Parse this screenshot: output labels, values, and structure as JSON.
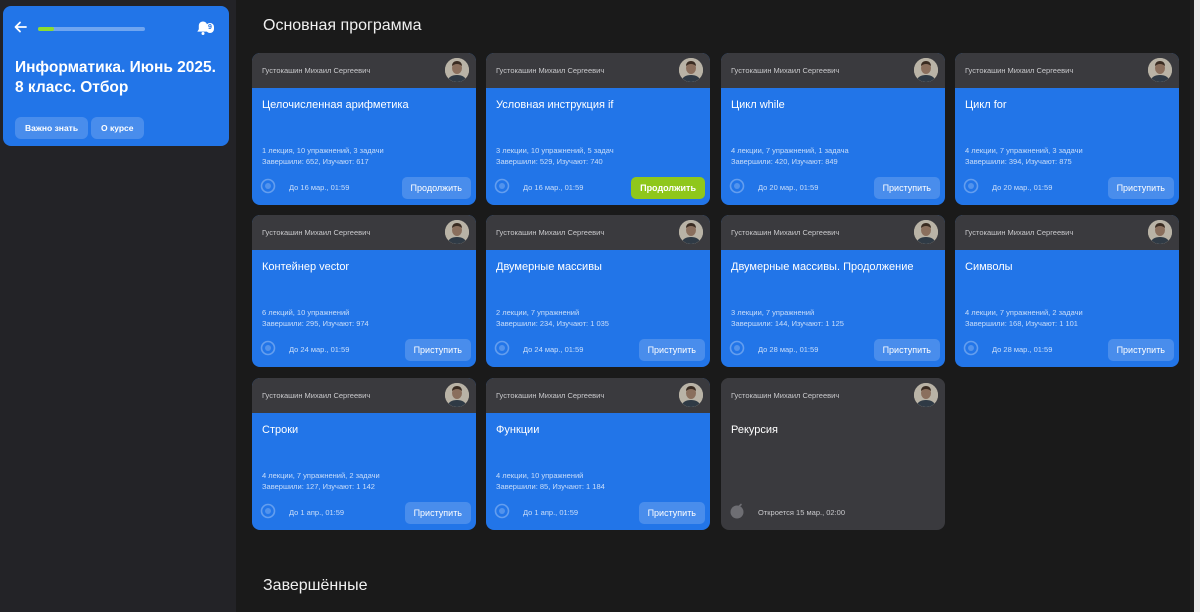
{
  "colors": {
    "card_blue": "#2275e8",
    "card_gray": "#3a3a3e",
    "accent_green": "#8fc71b",
    "background": "#1a1a1a"
  },
  "course": {
    "title": "Информатика. Июнь 2025. 8 класс. Отбор",
    "progress_fraction": 0.15,
    "notifications_count": "9",
    "buttons": [
      "Важно знать",
      "О курсе"
    ]
  },
  "sections": {
    "main_title": "Основная программа",
    "completed_title": "Завершённые"
  },
  "cards": [
    {
      "author": "Густокашин Михаил Сергеевич",
      "title": "Целочисленная арифметика",
      "stats1": "1 лекция, 10 упражнений, 3 задачи",
      "stats2": "Завершили: 652, Изучают: 617",
      "deadline": "До 16 мар., 01:59",
      "action": "Продолжить",
      "state": "blue"
    },
    {
      "author": "Густокашин Михаил Сергеевич",
      "title": "Условная инструкция if",
      "stats1": "3 лекции, 10 упражнений, 5 задач",
      "stats2": "Завершили: 529, Изучают: 740",
      "deadline": "До 16 мар., 01:59",
      "action": "Продолжить",
      "state": "green"
    },
    {
      "author": "Густокашин Михаил Сергеевич",
      "title": "Цикл while",
      "stats1": "4 лекции, 7 упражнений, 1 задача",
      "stats2": "Завершили: 420, Изучают: 849",
      "deadline": "До 20 мар., 01:59",
      "action": "Приступить",
      "state": "blue"
    },
    {
      "author": "Густокашин Михаил Сергеевич",
      "title": "Цикл for",
      "stats1": "4 лекции, 7 упражнений, 3 задачи",
      "stats2": "Завершили: 394, Изучают: 875",
      "deadline": "До 20 мар., 01:59",
      "action": "Приступить",
      "state": "blue"
    },
    {
      "author": "Густокашин Михаил Сергеевич",
      "title": "Контейнер vector",
      "stats1": "6 лекций, 10 упражнений",
      "stats2": "Завершили: 295, Изучают: 974",
      "deadline": "До 24 мар., 01:59",
      "action": "Приступить",
      "state": "blue"
    },
    {
      "author": "Густокашин Михаил Сергеевич",
      "title": "Двумерные массивы",
      "stats1": "2 лекции, 7 упражнений",
      "stats2": "Завершили: 234, Изучают: 1 035",
      "deadline": "До 24 мар., 01:59",
      "action": "Приступить",
      "state": "blue"
    },
    {
      "author": "Густокашин Михаил Сергеевич",
      "title": "Двумерные массивы. Продолжение",
      "stats1": "3 лекции, 7 упражнений",
      "stats2": "Завершили: 144, Изучают: 1 125",
      "deadline": "До 28 мар., 01:59",
      "action": "Приступить",
      "state": "blue"
    },
    {
      "author": "Густокашин Михаил Сергеевич",
      "title": "Символы",
      "stats1": "4 лекции, 7 упражнений, 2 задачи",
      "stats2": "Завершили: 168, Изучают: 1 101",
      "deadline": "До 28 мар., 01:59",
      "action": "Приступить",
      "state": "blue"
    },
    {
      "author": "Густокашин Михаил Сергеевич",
      "title": "Строки",
      "stats1": "4 лекции, 7 упражнений, 2 задачи",
      "stats2": "Завершили: 127, Изучают: 1 142",
      "deadline": "До 1 апр., 01:59",
      "action": "Приступить",
      "state": "blue"
    },
    {
      "author": "Густокашин Михаил Сергеевич",
      "title": "Функции",
      "stats1": "4 лекции, 10 упражнений",
      "stats2": "Завершили: 85, Изучают: 1 184",
      "deadline": "До 1 апр., 01:59",
      "action": "Приступить",
      "state": "blue"
    },
    {
      "author": "Густокашин Михаил Сергеевич",
      "title": "Рекурсия",
      "stats1": "",
      "stats2": "",
      "deadline": "Откроется 15 мар., 02:00",
      "action": "",
      "state": "locked"
    }
  ]
}
